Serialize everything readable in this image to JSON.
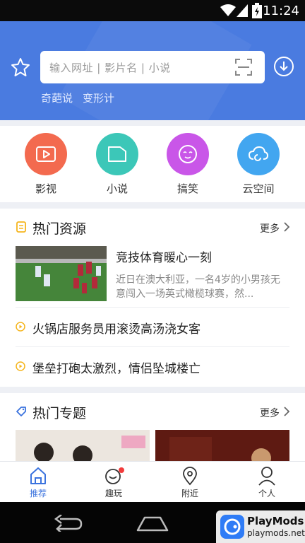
{
  "status_bar": {
    "time": "11:24"
  },
  "header": {
    "search_placeholder": "输入网址 | 影片名 | 小说",
    "quick_links": [
      "奇葩说",
      "变形计"
    ]
  },
  "categories": [
    {
      "label": "影视",
      "icon": "video-icon",
      "color": "#f36a4f"
    },
    {
      "label": "小说",
      "icon": "novel-icon",
      "color": "#3cc7b8"
    },
    {
      "label": "搞笑",
      "icon": "funny-face-icon",
      "color": "#c956e8"
    },
    {
      "label": "云空间",
      "icon": "cloud-icon",
      "color": "#42a6f0"
    }
  ],
  "hot_resources": {
    "title": "热门资源",
    "more": "更多",
    "featured": {
      "headline": "竞技体育暖心一刻",
      "summary": "近日在澳大利亚，一名4岁的小男孩无意闯入一场英式橄榄球赛，然..."
    },
    "items": [
      "火锅店服务员用滚烫高汤浇女客",
      "堡垒打砲太激烈，情侣坠城楼亡"
    ]
  },
  "hot_topics": {
    "title": "热门专题",
    "more": "更多"
  },
  "tabs": [
    {
      "label": "推荐",
      "icon": "home-icon"
    },
    {
      "label": "趣玩",
      "icon": "fun-icon"
    },
    {
      "label": "附近",
      "icon": "location-icon"
    },
    {
      "label": "个人",
      "icon": "person-icon"
    }
  ],
  "watermark": {
    "name": "PlayMods",
    "site": "playmods.net"
  },
  "colors": {
    "primary": "#4a7be0",
    "accent": "#3b73de",
    "bullet": "#f5b51d"
  }
}
